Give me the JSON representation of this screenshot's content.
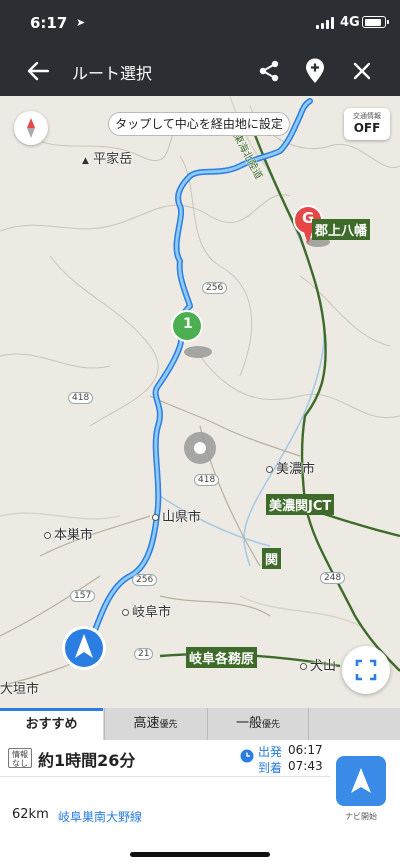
{
  "status": {
    "time": "6:17",
    "network": "4G"
  },
  "app_bar": {
    "title": "ルート選択"
  },
  "map": {
    "hint": "タップして中心を経由地に設定",
    "traffic": {
      "title": "交通情報",
      "state": "OFF"
    },
    "places": {
      "mountain": "平家岳",
      "destination": "郡上八幡",
      "mino_city": "美濃市",
      "mino_seki_jct": "美濃関JCT",
      "yamagata_city": "山県市",
      "seki": "関",
      "motosu_city": "本巣市",
      "gifu_city": "岐阜市",
      "kakamigahara": "岐阜各務原",
      "inuyama": "犬山",
      "ogaki_city": "大垣市",
      "tokai_hokuriku": "東海北陸道"
    },
    "road_numbers": [
      "256",
      "418",
      "418",
      "157",
      "256",
      "21",
      "248"
    ],
    "markers": {
      "destination": "G",
      "waypoint": "1"
    },
    "colors": {
      "route": "#4aa3f0",
      "expressway": "#3f6b2a",
      "destination": "#e64646",
      "waypoint": "#4caf50"
    }
  },
  "tabs": [
    {
      "label": "おすすめ",
      "suffix": "",
      "selected": true
    },
    {
      "label": "高速",
      "suffix": "優先",
      "selected": false
    },
    {
      "label": "一般",
      "suffix": "優先",
      "selected": false
    }
  ],
  "summary": {
    "info_badge": "情報なし",
    "duration": "約1時間26分",
    "depart_label": "出発",
    "depart_time": "06:17",
    "arrive_label": "到着",
    "arrive_time": "07:43",
    "distance": "62km",
    "via": "岐阜巣南大野線",
    "nav_label": "ナビ開始"
  },
  "icons": [
    "location-arrow-icon",
    "signal-icon",
    "battery-icon",
    "back-arrow-icon",
    "share-icon",
    "add-pin-icon",
    "close-icon",
    "compass-icon",
    "current-location-icon",
    "fit-route-icon",
    "clock-icon",
    "navigate-icon"
  ]
}
